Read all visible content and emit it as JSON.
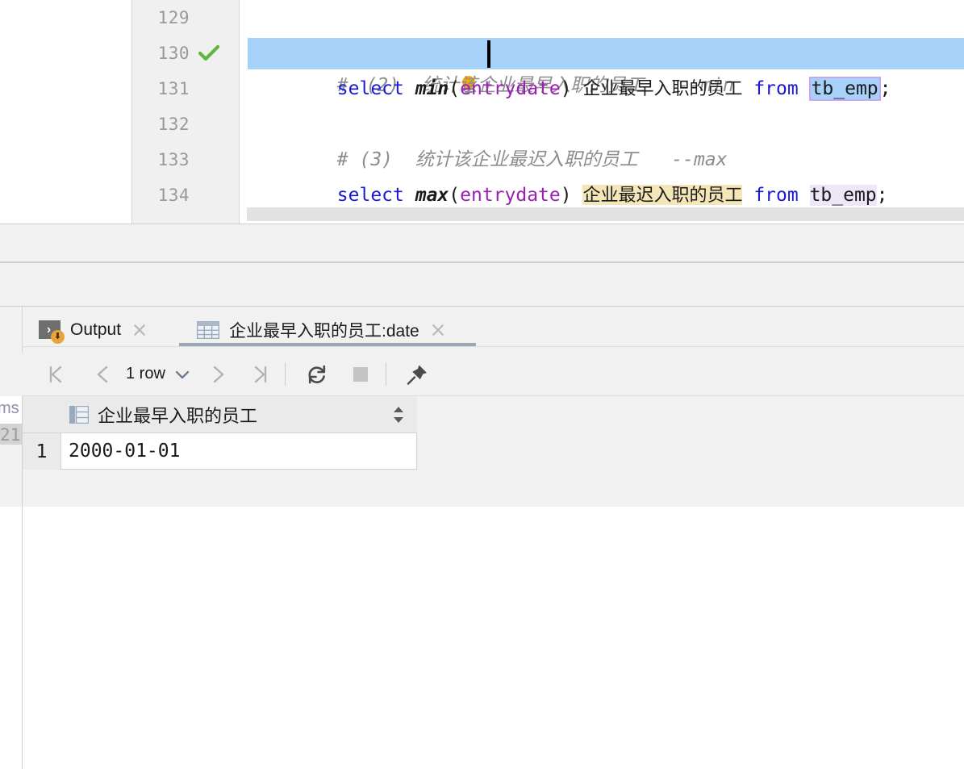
{
  "editor": {
    "lines": [
      {
        "number": "129",
        "executed": false,
        "current": false,
        "tokens": [
          {
            "t": "# ",
            "k": "cmt"
          },
          {
            "t": "bulb",
            "k": "bulb"
          },
          {
            "t": "(2)  ",
            "k": "cmt"
          },
          {
            "t": "统计该企业最早入职的员工",
            "k": "cmt-cn"
          },
          {
            "t": "   --min",
            "k": "cmt"
          }
        ]
      },
      {
        "number": "130",
        "executed": true,
        "current": true,
        "tokens": [
          {
            "t": "select ",
            "k": "kw"
          },
          {
            "t": "min",
            "k": "fn"
          },
          {
            "t": "(",
            "k": "plain"
          },
          {
            "t": "entrydate",
            "k": "col"
          },
          {
            "t": ") ",
            "k": "plain"
          },
          {
            "t": "企业最早入职的员工",
            "k": "cn"
          },
          {
            "t": " ",
            "k": "plain"
          },
          {
            "t": "from ",
            "k": "kw"
          },
          {
            "t": "tb_emp",
            "k": "plain-box"
          },
          {
            "t": ";",
            "k": "plain"
          }
        ]
      },
      {
        "number": "131",
        "executed": false,
        "current": false,
        "tokens": []
      },
      {
        "number": "132",
        "executed": false,
        "current": false,
        "tokens": [
          {
            "t": "# (3)  ",
            "k": "cmt"
          },
          {
            "t": "统计该企业最迟入职的员工",
            "k": "cmt-cn"
          },
          {
            "t": "   --max",
            "k": "cmt"
          }
        ]
      },
      {
        "number": "133",
        "executed": false,
        "current": false,
        "tokens": [
          {
            "t": "select ",
            "k": "kw"
          },
          {
            "t": "max",
            "k": "fn"
          },
          {
            "t": "(",
            "k": "plain"
          },
          {
            "t": "entrydate",
            "k": "col"
          },
          {
            "t": ") ",
            "k": "plain"
          },
          {
            "t": "企业最迟入职的员工",
            "k": "cn-yellow"
          },
          {
            "t": " ",
            "k": "plain"
          },
          {
            "t": "from ",
            "k": "kw"
          },
          {
            "t": "tb_emp",
            "k": "plain-purple"
          },
          {
            "t": ";",
            "k": "plain"
          }
        ]
      },
      {
        "number": "134",
        "executed": false,
        "current": false,
        "tokens": []
      }
    ],
    "line_129_text": "#  (2)  统计该企业最早入职的员工   --min",
    "line_130_text": "select min(entrydate) 企业最早入职的员工 from tb_emp;",
    "line_132_text": "# (3)  统计该企业最迟入职的员工   --max",
    "line_133_text": "select max(entrydate) 企业最迟入职的员工 from tb_emp;"
  },
  "panel": {
    "tabs": [
      {
        "label": "Output",
        "icon": "output-console-icon",
        "active": false
      },
      {
        "label": "企业最早入职的员工:date",
        "icon": "data-grid-icon",
        "active": true
      }
    ],
    "toolbar": {
      "first_page": "first-page-icon",
      "prev_page": "prev-page-icon",
      "row_count": "1 row",
      "dropdown": "chevron-down-icon",
      "next_page": "next-page-icon",
      "last_page": "last-page-icon",
      "refresh": "refresh-icon",
      "stop": "stop-icon",
      "pin": "pin-icon"
    },
    "grid": {
      "columns": [
        "企业最早入职的员工"
      ],
      "rows": [
        {
          "num": "1",
          "values": [
            "2000-01-01"
          ]
        }
      ]
    }
  },
  "background_peek": {
    "duration_text": "ms",
    "line_number": "21"
  },
  "colors": {
    "selection": "#a6d2fa",
    "identifier_box": "#c9a6f0",
    "current_line": "#fdfbee",
    "keyword": "#1a1ad6",
    "column": "#9b1fb3",
    "comment": "#8d8d8d",
    "highlight_yellow": "#f5e6b8",
    "highlight_purple": "#ece6f7",
    "tab_active_underline": "#9aa7b8",
    "success_check": "#62b543",
    "accent_orange": "#e8a33d"
  }
}
